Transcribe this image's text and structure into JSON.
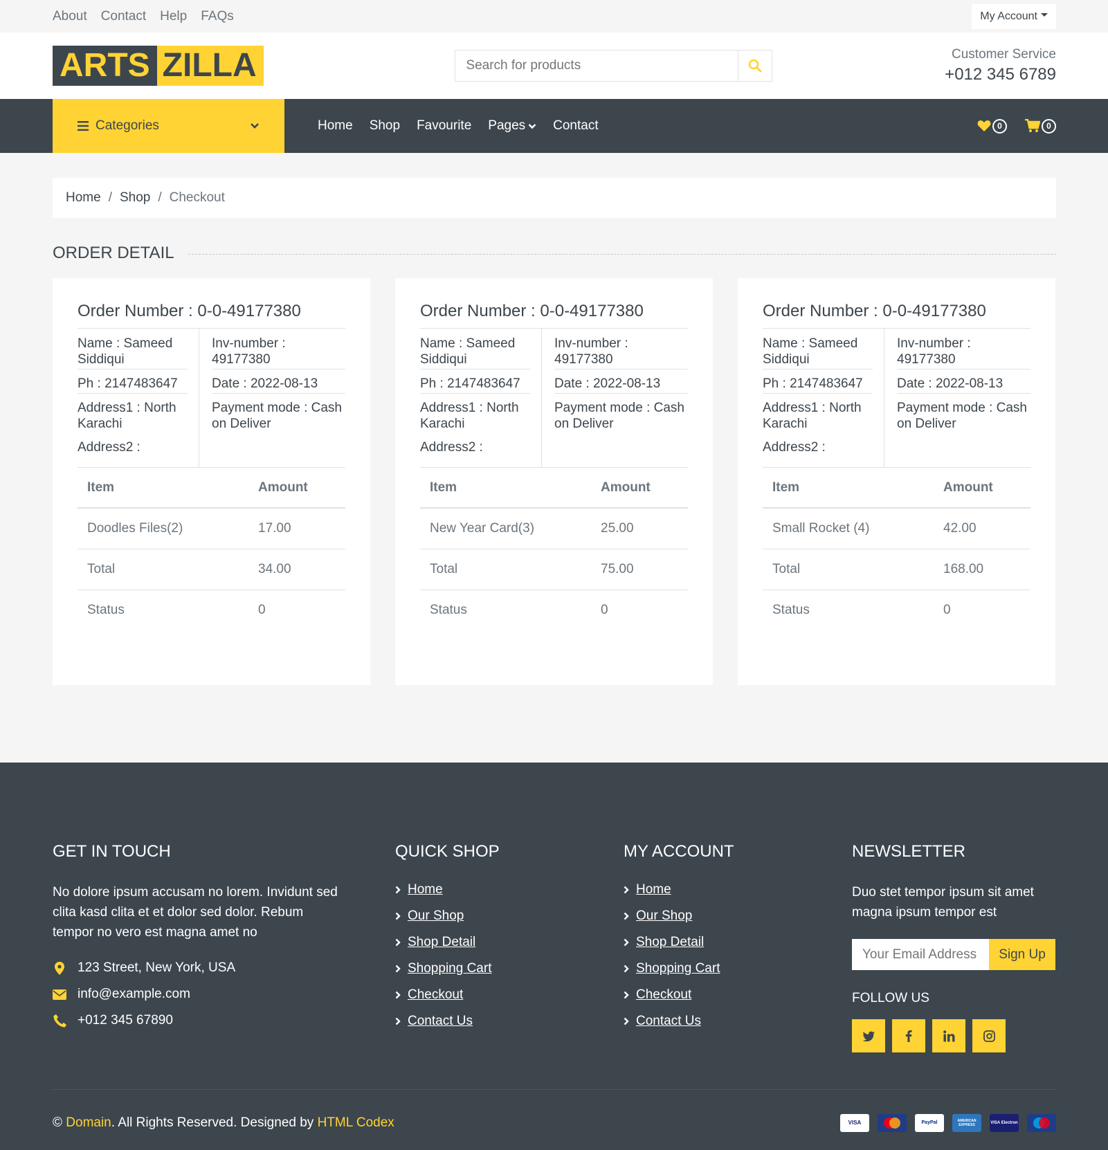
{
  "topbar": {
    "links": [
      "About",
      "Contact",
      "Help",
      "FAQs"
    ],
    "account_label": "My Account"
  },
  "header": {
    "logo_part1": "ARTS",
    "logo_part2": "ZILLA",
    "search_placeholder": "Search for products",
    "cs_label": "Customer Service",
    "cs_phone": "+012 345 6789"
  },
  "nav": {
    "categories_label": "Categories",
    "items": [
      "Home",
      "Shop",
      "Favourite",
      "Pages",
      "Contact"
    ],
    "wishlist_count": "0",
    "cart_count": "0"
  },
  "breadcrumb": {
    "items": [
      "Home",
      "Shop"
    ],
    "current": "Checkout"
  },
  "section_title": "Order Detail",
  "orders": [
    {
      "title": "Order Number : 0-0-49177380",
      "name": "Name : Sameed Siddiqui",
      "phone": "Ph : 2147483647",
      "address1": "Address1 : North Karachi",
      "address2": "Address2 :",
      "inv": "Inv-number : 49177380",
      "date": "Date : 2022-08-13",
      "payment": "Payment mode : Cash on Deliver",
      "th_item": "Item",
      "th_amount": "Amount",
      "item": "Doodles Files(2)",
      "item_amount": "17.00",
      "total_label": "Total",
      "total": "34.00",
      "status_label": "Status",
      "status": "0"
    },
    {
      "title": "Order Number : 0-0-49177380",
      "name": "Name : Sameed Siddiqui",
      "phone": "Ph : 2147483647",
      "address1": "Address1 : North Karachi",
      "address2": "Address2 :",
      "inv": "Inv-number : 49177380",
      "date": "Date : 2022-08-13",
      "payment": "Payment mode : Cash on Deliver",
      "th_item": "Item",
      "th_amount": "Amount",
      "item": "New Year Card(3)",
      "item_amount": "25.00",
      "total_label": "Total",
      "total": "75.00",
      "status_label": "Status",
      "status": "0"
    },
    {
      "title": "Order Number : 0-0-49177380",
      "name": "Name : Sameed Siddiqui",
      "phone": "Ph : 2147483647",
      "address1": "Address1 : North Karachi",
      "address2": "Address2 :",
      "inv": "Inv-number : 49177380",
      "date": "Date : 2022-08-13",
      "payment": "Payment mode : Cash on Deliver",
      "th_item": "Item",
      "th_amount": "Amount",
      "item": "Small Rocket (4)",
      "item_amount": "42.00",
      "total_label": "Total",
      "total": "168.00",
      "status_label": "Status",
      "status": "0"
    }
  ],
  "footer": {
    "touch_title": "Get In Touch",
    "touch_text": "No dolore ipsum accusam no lorem. Invidunt sed clita kasd clita et et dolor sed dolor. Rebum tempor no vero est magna amet no",
    "address": "123 Street, New York, USA",
    "email": "info@example.com",
    "phone": "+012 345 67890",
    "quick_title": "Quick Shop",
    "quick_links": [
      "Home",
      "Our Shop",
      "Shop Detail",
      "Shopping Cart",
      "Checkout",
      "Contact Us"
    ],
    "account_title": "My Account",
    "account_links": [
      "Home",
      "Our Shop",
      "Shop Detail",
      "Shopping Cart",
      "Checkout",
      "Contact Us"
    ],
    "newsletter_title": "Newsletter",
    "newsletter_text": "Duo stet tempor ipsum sit amet magna ipsum tempor est",
    "email_placeholder": "Your Email Address",
    "signup_label": "Sign Up",
    "follow_label": "Follow Us",
    "social_icons": [
      "twitter-icon",
      "facebook-icon",
      "linkedin-icon",
      "instagram-icon"
    ],
    "copy_prefix": "©",
    "copy_domain": "Domain",
    "copy_middle": ". All Rights Reserved. Designed by",
    "copy_designer": "HTML Codex",
    "payments": [
      "VISA",
      "MasterCard",
      "PayPal",
      "AMERICAN EXPRESS",
      "VISA Electron",
      "Maestro"
    ]
  },
  "colors": {
    "accent": "#ffd333",
    "dark": "#3d464d",
    "muted": "#6c757d",
    "page_bg": "#f5f5f5"
  }
}
